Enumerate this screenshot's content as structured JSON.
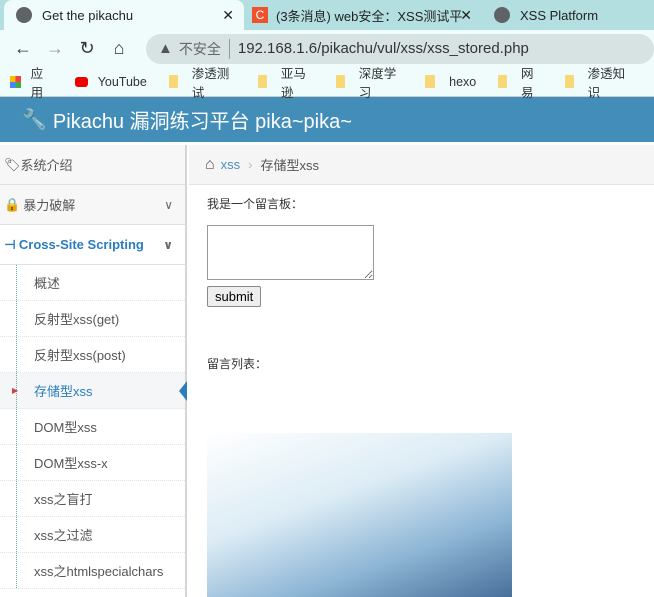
{
  "browser": {
    "tabs": [
      {
        "title": "Get the pikachu"
      },
      {
        "title": "(3条消息) web安全：XSS测试平"
      },
      {
        "title": "XSS Platform"
      }
    ],
    "security": "不安全",
    "url": "192.168.1.6/pikachu/vul/xss/xss_stored.php",
    "bookmarks": [
      "应用",
      "YouTube",
      "渗透测试",
      "亚马逊",
      "深度学习",
      "hexo",
      "网易",
      "渗透知识"
    ]
  },
  "header": {
    "title": "Pikachu 漏洞练习平台 pika~pika~"
  },
  "sidebar": {
    "items": [
      "系统介绍",
      "暴力破解",
      "Cross-Site Scripting"
    ],
    "sub": [
      "概述",
      "反射型xss(get)",
      "反射型xss(post)",
      "存储型xss",
      "DOM型xss",
      "DOM型xss-x",
      "xss之盲打",
      "xss之过滤",
      "xss之htmlspecialchars"
    ]
  },
  "breadcrumb": {
    "parent": "xss",
    "current": "存储型xss"
  },
  "main": {
    "label": "我是一个留言板：",
    "submit": "submit",
    "list_label": "留言列表："
  }
}
